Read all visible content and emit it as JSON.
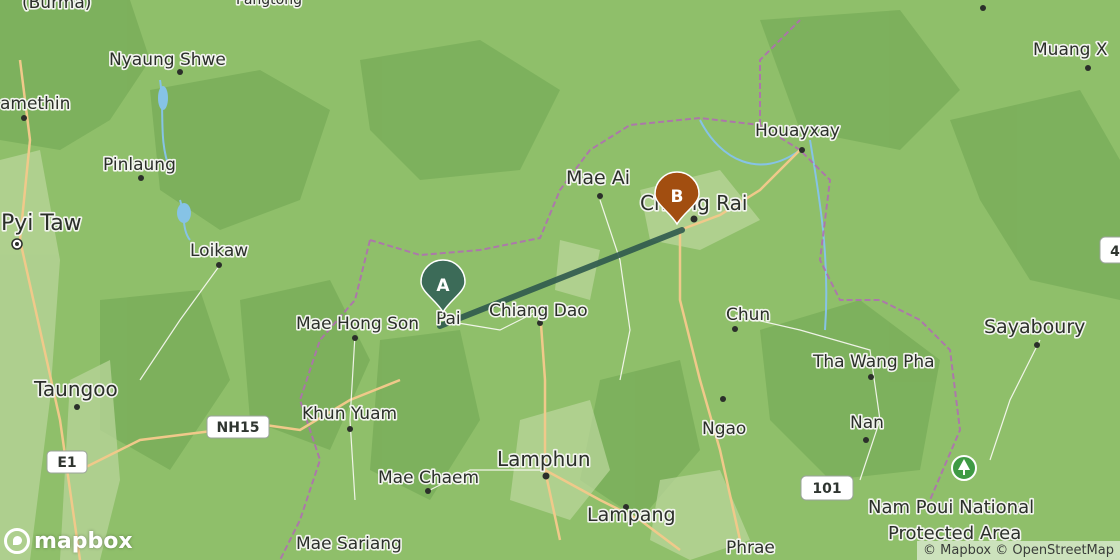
{
  "map": {
    "attribution": "© Mapbox © OpenStreetMap",
    "logo": "mapbox",
    "colors": {
      "land": "#8fbf6a",
      "forest_dark": "#6fa552",
      "valley": "#b9d59b",
      "road_major": "#f0c98a",
      "road_minor": "#fbfbf5",
      "border": "#b26bb5",
      "river": "#86c3e6",
      "route": "#2f5a4e",
      "marker_a": "#3c6b58",
      "marker_b": "#a24e10"
    },
    "markers": [
      {
        "id": "A",
        "label": "A"
      },
      {
        "id": "B",
        "label": "B"
      }
    ],
    "places": [
      {
        "name": "(Burma)"
      },
      {
        "name": "Pangtong"
      },
      {
        "name": "Nyaung Shwe"
      },
      {
        "name": "amethin"
      },
      {
        "name": "Pinlaung"
      },
      {
        "name": "Pyi Taw"
      },
      {
        "name": "Loikaw"
      },
      {
        "name": "Taungoo"
      },
      {
        "name": "Mae Hong Son"
      },
      {
        "name": "Pai"
      },
      {
        "name": "Chiang Dao"
      },
      {
        "name": "Mae Ai"
      },
      {
        "name": "Chiang Rai"
      },
      {
        "name": "Houayxay"
      },
      {
        "name": "Muang X"
      },
      {
        "name": "Chun"
      },
      {
        "name": "Sayaboury"
      },
      {
        "name": "Tha Wang Pha"
      },
      {
        "name": "Khun Yuam"
      },
      {
        "name": "Ngao"
      },
      {
        "name": "Nan"
      },
      {
        "name": "Lamphun"
      },
      {
        "name": "Mae Chaem"
      },
      {
        "name": "Lampang"
      },
      {
        "name": "Mae Sariang"
      },
      {
        "name": "Phrae"
      },
      {
        "name": "Nam Poui National"
      },
      {
        "name": "Protected Area"
      }
    ],
    "shields": [
      {
        "label": "NH15"
      },
      {
        "label": "E1"
      },
      {
        "label": "101"
      },
      {
        "label": "4"
      }
    ]
  }
}
